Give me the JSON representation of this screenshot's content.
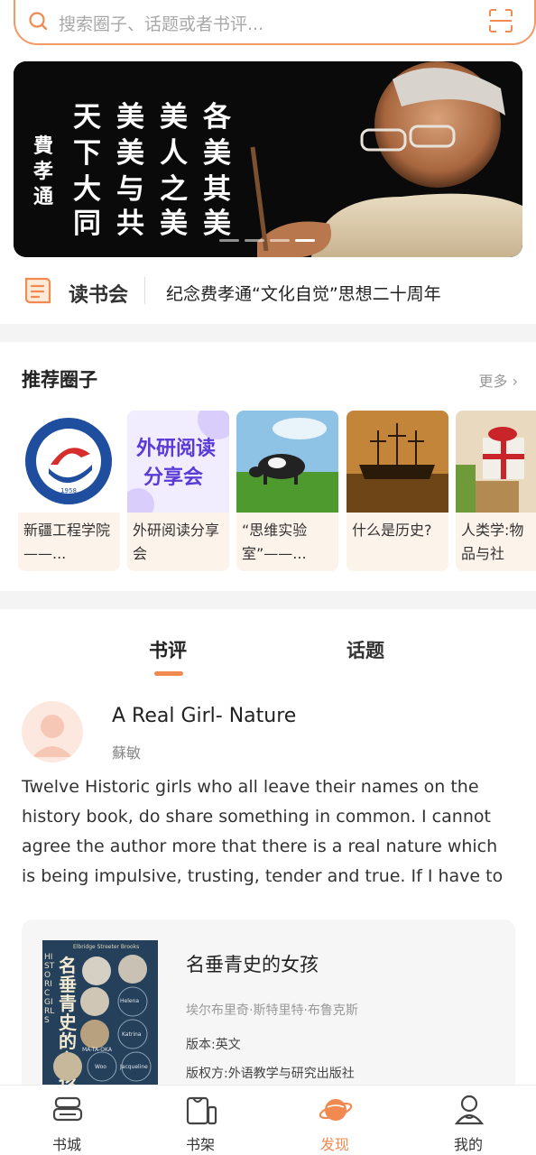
{
  "search": {
    "placeholder": "搜索圈子、话题或者书评..."
  },
  "banner": {
    "signature": "费孝通",
    "calligraphy": [
      "各美其美",
      "美人之美",
      "美美与共",
      "天下大同"
    ],
    "slide_count": 4,
    "active_slide": 4
  },
  "reading_club": {
    "title": "读书会",
    "headline": "纪念费孝通“文化自觉”思想二十周年"
  },
  "recommended": {
    "title": "推荐圈子",
    "more": "更多",
    "items": [
      {
        "name": "新疆工程学院——...",
        "logo_text": "新疆工程学院",
        "logo_en": "XINJIANG INSTITUTE OF ENGINEERING",
        "year": "1958"
      },
      {
        "name": "外研阅读分享会",
        "cover_line1": "外研阅读",
        "cover_line2": "分享会"
      },
      {
        "name": "“思维实验室”——..."
      },
      {
        "name": "什么是历史?"
      },
      {
        "name": "人类学:物品与社"
      }
    ]
  },
  "feed": {
    "tabs": [
      "书评",
      "话题"
    ],
    "active_tab": "书评",
    "review": {
      "title": "A Real Girl- Nature",
      "author": "蘇敏",
      "body": "Twelve Historic girls who all leave their names on the history book, do share something in common. I cannot agree the author more that there is a real nature which is being impulsive, trusting, tender and true. If I have to"
    },
    "book": {
      "title": "名垂青史的女孩",
      "author": "埃尔布里奇·斯特里特·布鲁克斯",
      "edition": "版本:英文",
      "publisher": "版权方:外语教学与研究出版社",
      "cover_title": "名垂青史的女孩",
      "cover_en": "HISTORIC GIRLS",
      "cover_series": "Elbridge Streeter Brooks",
      "cover_names": [
        "Helena",
        "MA-TA-OKA",
        "Katrina",
        "Woo",
        "Jacqueline"
      ]
    }
  },
  "nav": {
    "items": [
      {
        "label": "书城",
        "icon": "bookstore-icon"
      },
      {
        "label": "书架",
        "icon": "bookshelf-icon"
      },
      {
        "label": "发现",
        "icon": "planet-icon"
      },
      {
        "label": "我的",
        "icon": "profile-icon"
      }
    ],
    "active": "发现"
  },
  "colors": {
    "accent": "#f08a50",
    "card_bg": "#fcf3ea"
  }
}
